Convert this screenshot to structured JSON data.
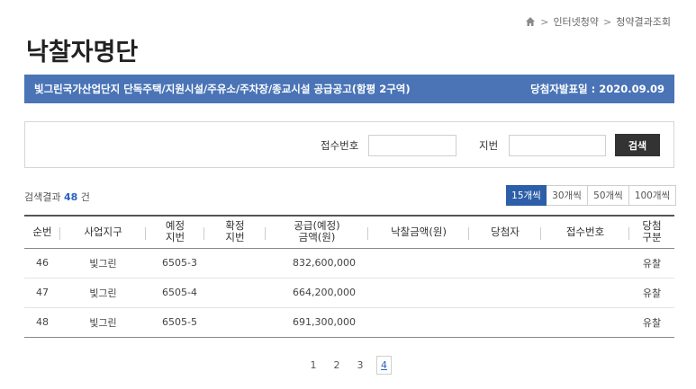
{
  "breadcrumb": {
    "icon": "home-icon",
    "items": [
      "인터넷청약",
      "청약결과조회"
    ]
  },
  "page_title": "낙찰자명단",
  "notice": {
    "title": "빛그린국가산업단지 단독주택/지원시설/주유소/주차장/종교시설 공급공고(함평 2구역)",
    "announce_date": "당첨자발표일 : 2020.09.09"
  },
  "search": {
    "receipt_label": "접수번호",
    "receipt_value": "",
    "lot_label": "지번",
    "lot_value": "",
    "button_label": "검색"
  },
  "result": {
    "label": "검색결과",
    "count": "48",
    "unit": "건"
  },
  "page_size": {
    "options": [
      "15개씩",
      "30개씩",
      "50개씩",
      "100개씩"
    ],
    "selected": "15개씩"
  },
  "table": {
    "headers": [
      "순번",
      "사업지구",
      "예정\n지번",
      "확정\n지번",
      "공급(예정)\n금액(원)",
      "낙찰금액(원)",
      "당첨자",
      "접수번호",
      "당첨\n구분"
    ],
    "rows": [
      {
        "no": "46",
        "area": "빛그린",
        "planned_lot": "6505-3",
        "confirmed_lot": "",
        "supply_amount": "832,600,000",
        "winning_amount": "",
        "winner": "",
        "receipt_no": "",
        "result": "유찰"
      },
      {
        "no": "47",
        "area": "빛그린",
        "planned_lot": "6505-4",
        "confirmed_lot": "",
        "supply_amount": "664,200,000",
        "winning_amount": "",
        "winner": "",
        "receipt_no": "",
        "result": "유찰"
      },
      {
        "no": "48",
        "area": "빛그린",
        "planned_lot": "6505-5",
        "confirmed_lot": "",
        "supply_amount": "691,300,000",
        "winning_amount": "",
        "winner": "",
        "receipt_no": "",
        "result": "유찰"
      }
    ]
  },
  "pagination": {
    "pages": [
      "1",
      "2",
      "3",
      "4"
    ],
    "current": "4"
  },
  "colors": {
    "notice_bar": "#4a74b6",
    "active_page_size": "#2d5ea8",
    "search_button": "#333333",
    "highlight_text": "#2b62c0"
  }
}
